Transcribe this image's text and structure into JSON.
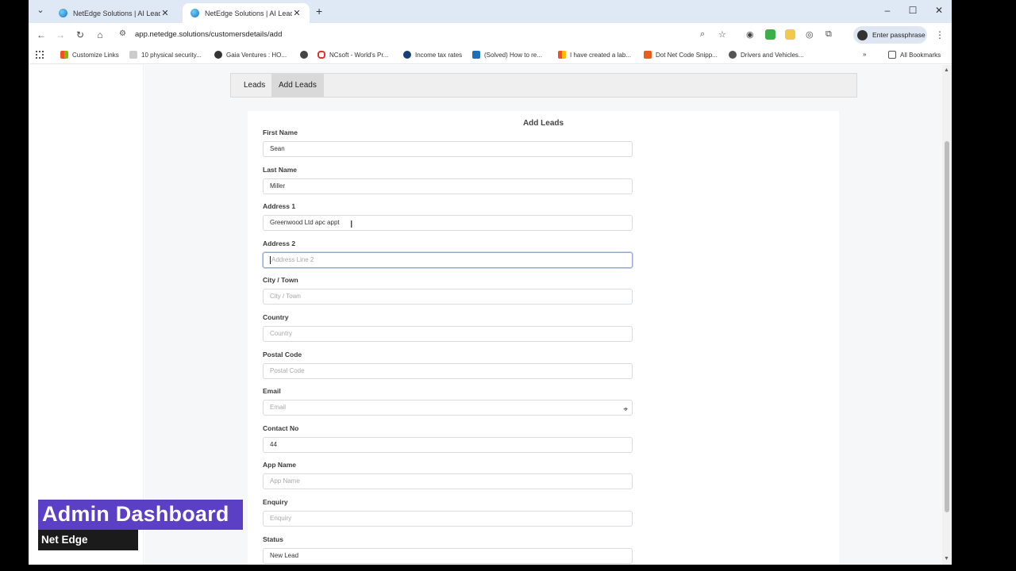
{
  "browser": {
    "tabs": [
      {
        "title": "NetEdge Solutions | AI Leads G",
        "active": false
      },
      {
        "title": "NetEdge Solutions | AI Leads G",
        "active": true
      }
    ],
    "url": "app.netedge.solutions/customersdetails/add",
    "profile_label": "Enter passphrase",
    "bookmarks": [
      "Customize Links",
      "10 physical security...",
      "Gaia Ventures : HO...",
      "",
      "NCsoft - World's Pr...",
      "Income tax rates",
      "(Solved) How to re...",
      "I have created a lab...",
      "Dot Net Code Snipp...",
      "Drivers and Vehicles..."
    ],
    "all_bookmarks": "All Bookmarks"
  },
  "subnav": {
    "leads": "Leads",
    "add_leads": "Add Leads"
  },
  "form": {
    "title": "Add Leads",
    "fields": [
      {
        "label": "First Name",
        "value": "Sean",
        "placeholder": ""
      },
      {
        "label": "Last Name",
        "value": "Miller",
        "placeholder": ""
      },
      {
        "label": "Address 1",
        "value": "Greenwood Ltd apc appt",
        "placeholder": ""
      },
      {
        "label": "Address 2",
        "value": "",
        "placeholder": "Address Line 2"
      },
      {
        "label": "City / Town",
        "value": "",
        "placeholder": "City / Town"
      },
      {
        "label": "Country",
        "value": "",
        "placeholder": "Country"
      },
      {
        "label": "Postal Code",
        "value": "",
        "placeholder": "Postal Code"
      },
      {
        "label": "Email",
        "value": "",
        "placeholder": "Email"
      },
      {
        "label": "Contact No",
        "value": "44",
        "placeholder": ""
      },
      {
        "label": "App Name",
        "value": "",
        "placeholder": "App Name"
      },
      {
        "label": "Enquiry",
        "value": "",
        "placeholder": "Enquiry"
      },
      {
        "label": "Status",
        "value": "New Lead",
        "placeholder": ""
      }
    ]
  },
  "overlay": {
    "title": "Admin Dashboard",
    "subtitle": "Net Edge Solutions"
  }
}
